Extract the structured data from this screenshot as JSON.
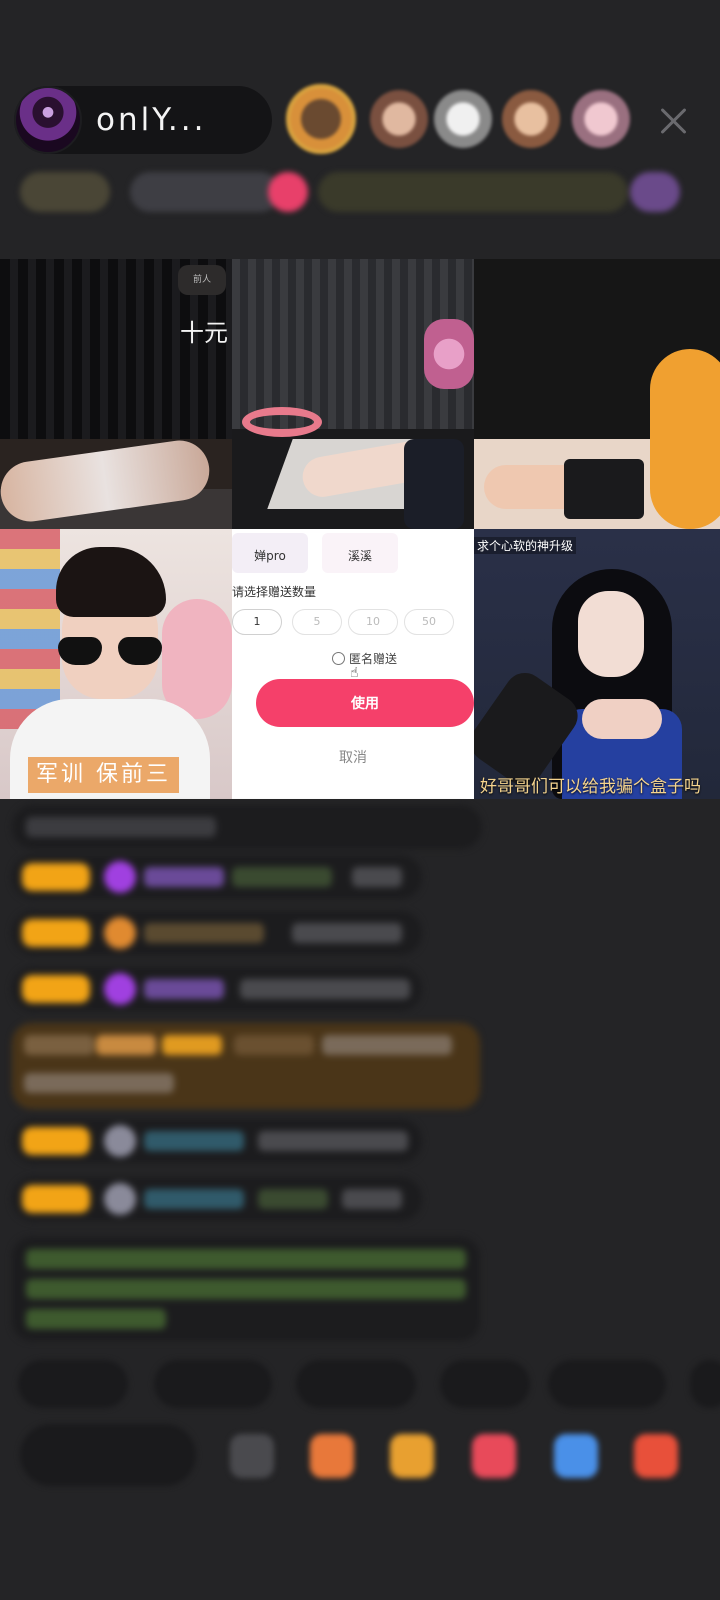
{
  "header": {
    "host_name": "onlY...",
    "close_icon": "close-icon"
  },
  "tiles": {
    "t1": {
      "overlay_text": "十元",
      "sticker_text": "前人"
    },
    "t4": {
      "caption": "军训  保前三"
    },
    "t6": {
      "top_caption": "求个心软的神升级",
      "caption": "好哥哥们可以给我骗个盒子吗"
    }
  },
  "gift_panel": {
    "chip1": "婵pro",
    "chip2": "溪溪",
    "qty_label": "请选择赠送数量",
    "qty_options": [
      "1",
      "5",
      "10",
      "50"
    ],
    "anonymous_label": "匿名赠送",
    "use_button": "使用",
    "cancel_button": "取消",
    "accent_color": "#f5406a"
  },
  "colors": {
    "background": "#242426",
    "level_badge": "#f2a416"
  }
}
